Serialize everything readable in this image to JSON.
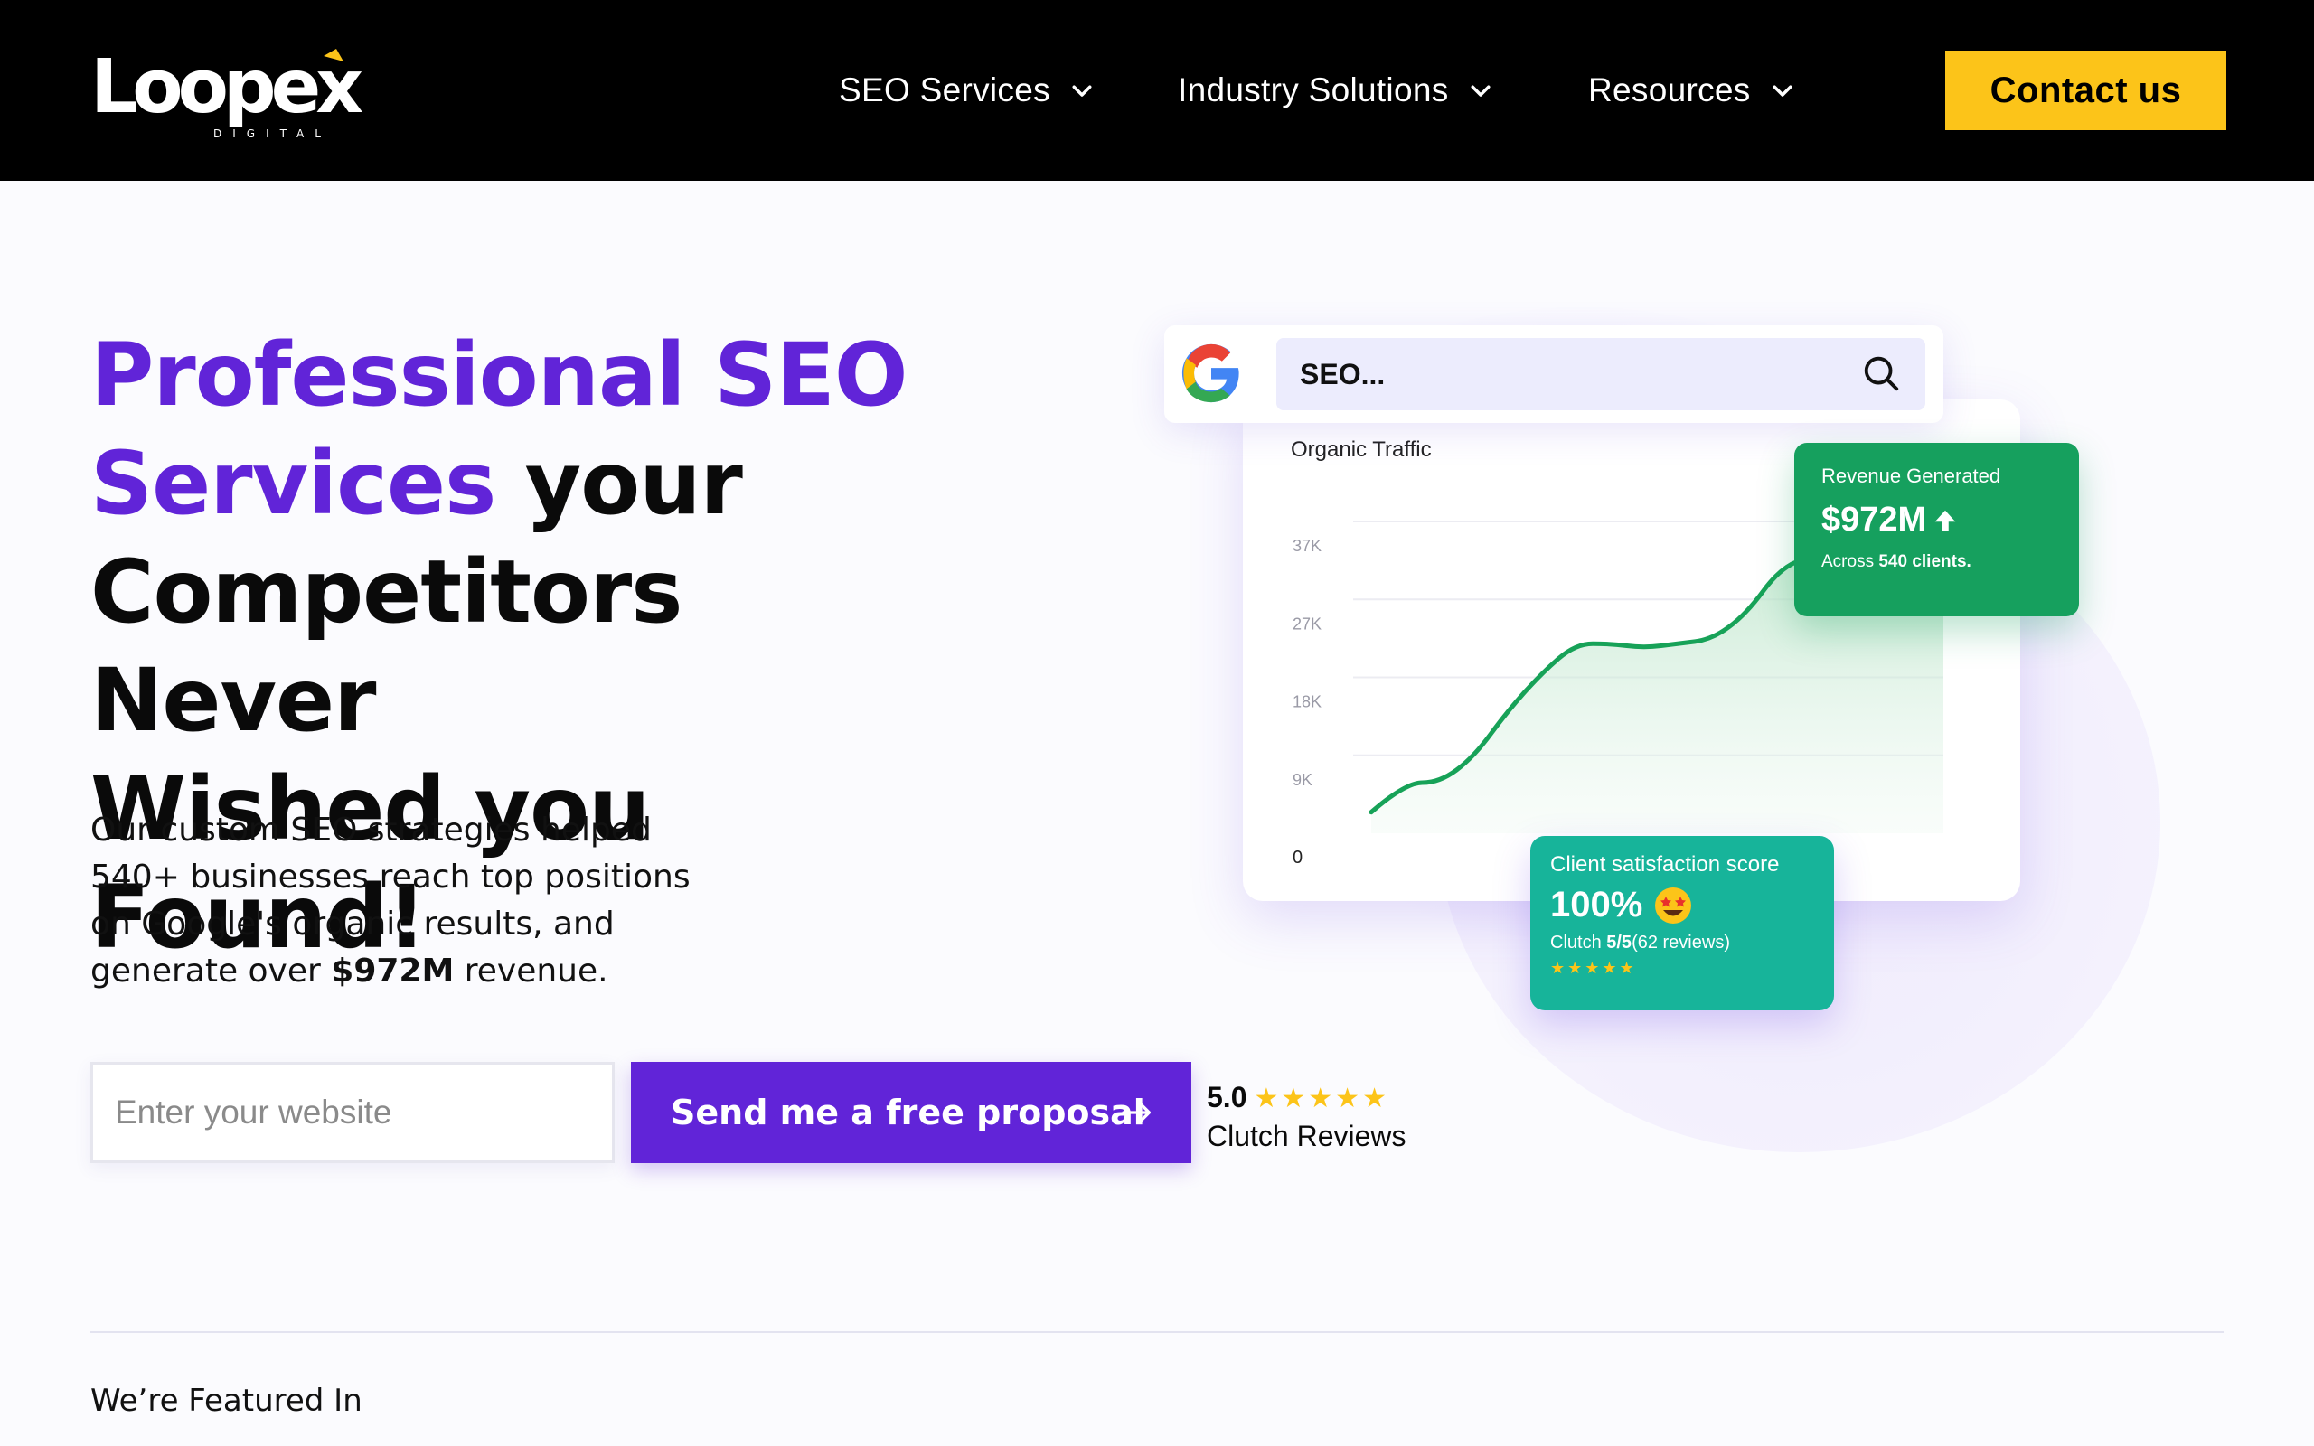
{
  "header": {
    "logo_text": "Loopex",
    "logo_subtext": "DIGITAL",
    "nav": [
      {
        "label": "SEO Services",
        "icon": "chevron-down-icon"
      },
      {
        "label": "Industry Solutions",
        "icon": "chevron-down-icon"
      },
      {
        "label": "Resources",
        "icon": "chevron-down-icon"
      }
    ],
    "contact_label": "Contact us"
  },
  "hero": {
    "headline_accent_1": "Professional SEO",
    "headline_accent_2": "Services",
    "headline_rest_1": " your",
    "headline_line_3": "Competitors Never",
    "headline_line_4": "Wished you Found!",
    "sub_part_1": "Our custom SEO strategies helped 540+ businesses reach top positions on Google's organic results, and generate over ",
    "sub_bold": "$972M",
    "sub_part_2": " revenue.",
    "input_placeholder": "Enter your website",
    "cta_label": "Send me a free proposal",
    "clutch_score": "5.0",
    "clutch_stars": "★★★★★",
    "clutch_label": "Clutch Reviews"
  },
  "illustration": {
    "search_text": "SEO...",
    "chart_title": "Organic Traffic",
    "y_ticks": [
      "37K",
      "27K",
      "18K",
      "9K",
      "0"
    ],
    "revenue_card": {
      "title": "Revenue Generated",
      "value": "$972M",
      "sub_prefix": "Across ",
      "sub_bold": "540 clients."
    },
    "satisfaction_card": {
      "title": "Client satisfaction score",
      "value": "100%",
      "sub_prefix": "Clutch ",
      "sub_bold": "5/5",
      "sub_suffix": "(62 reviews)",
      "stars": "★★★★★"
    },
    "colors": {
      "accent": "#6124d8",
      "cta_yellow": "#fcc419",
      "revenue_green": "#16a05e",
      "satisfaction_teal": "#17b49a"
    }
  },
  "chart_data": {
    "type": "area",
    "title": "Organic Traffic",
    "y_ticks": [
      "37K",
      "27K",
      "18K",
      "9K",
      "0"
    ],
    "ylim": [
      0,
      37000
    ],
    "values": [
      2500,
      6000,
      6000,
      9000,
      14500,
      19000,
      22500,
      22500,
      22000,
      22500,
      23000,
      26000,
      31500,
      33000,
      33000
    ]
  },
  "featured": {
    "label": "We’re Featured In"
  }
}
